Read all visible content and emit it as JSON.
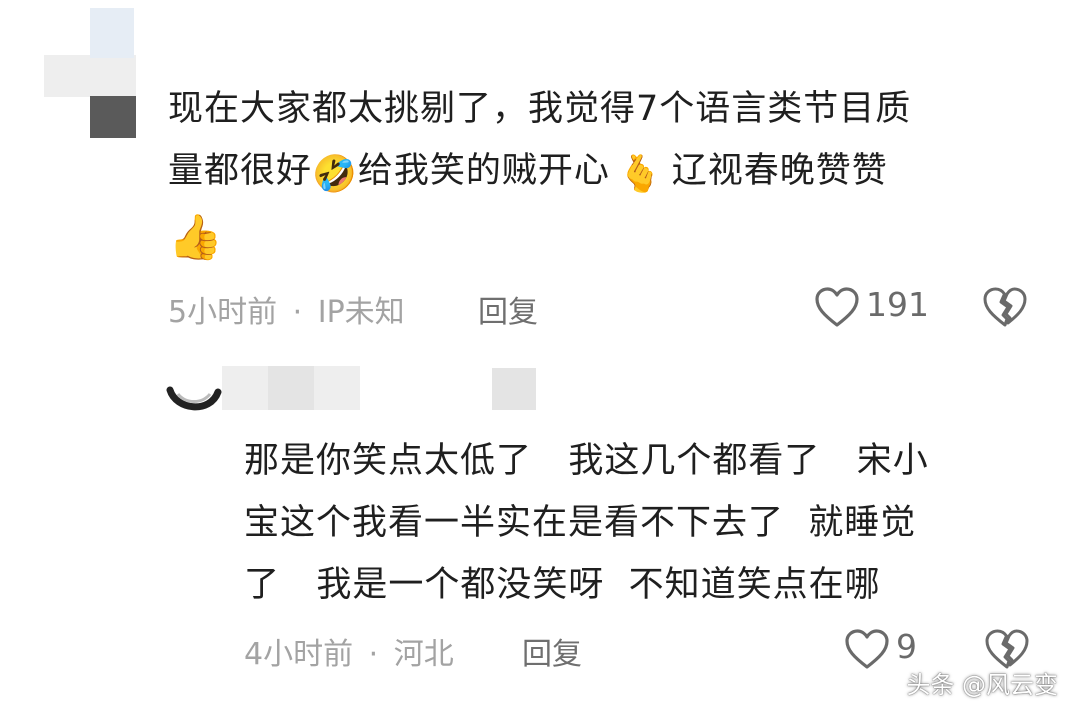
{
  "comment1": {
    "lines": [
      "现在大家都太挑剔了，我觉得7个语言类节目质",
      "量都很好",
      "给我笑的贼开心",
      "辽视春晚赞赞"
    ],
    "emojis": [
      "🤣",
      "🫰",
      "👍"
    ],
    "time": "5小时前",
    "location": "IP未知",
    "reply_label": "回复",
    "likes": "191"
  },
  "comment2": {
    "lines": [
      "那是你笑点太低了   我这几个都看了   宋小",
      "宝这个我看一半实在是看不下去了  就睡觉",
      "了   我是一个都没笑呀  不知道笑点在哪"
    ],
    "time": "4小时前",
    "location": "河北",
    "reply_label": "回复",
    "likes": "9"
  },
  "meta_separator": "·",
  "watermark": "头条 @风云变"
}
